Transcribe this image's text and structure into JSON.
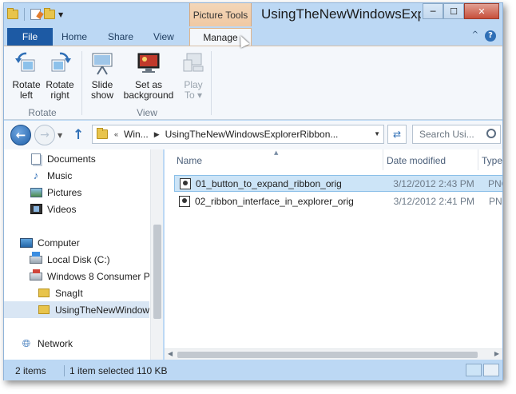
{
  "window": {
    "title": "UsingTheNewWindowsExplorerRibbon",
    "context_tab_group": "Picture Tools",
    "caption_buttons": {
      "minimize": "─",
      "maximize": "☐",
      "close": "✕"
    }
  },
  "tabs": [
    {
      "label": "File"
    },
    {
      "label": "Home"
    },
    {
      "label": "Share"
    },
    {
      "label": "View"
    },
    {
      "label": "Manage"
    }
  ],
  "tab_right": {
    "collapse": "^",
    "help": "?"
  },
  "ribbon": {
    "groups": [
      {
        "label": "Rotate",
        "buttons": [
          {
            "label": "Rotate left",
            "line1": "Rotate",
            "line2": "left",
            "icon": "rotate-left-icon"
          },
          {
            "label": "Rotate right",
            "line1": "Rotate",
            "line2": "right",
            "icon": "rotate-right-icon"
          }
        ]
      },
      {
        "label": "View",
        "buttons": [
          {
            "label": "Slide show",
            "line1": "Slide",
            "line2": "show",
            "icon": "slideshow-icon"
          },
          {
            "label": "Set as background",
            "line1": "Set as",
            "line2": "background",
            "icon": "set-background-icon"
          },
          {
            "label": "Play To",
            "line1": "Play",
            "line2": "To ▾",
            "icon": "play-to-icon",
            "disabled": true
          }
        ]
      }
    ]
  },
  "address": {
    "overflow": "«",
    "crumbs": [
      "Win...",
      "UsingTheNewWindowsExplorerRibbon..."
    ],
    "search_placeholder": "Search Usi..."
  },
  "nav_pane": {
    "items": [
      {
        "label": "Documents",
        "icon": "documents-icon"
      },
      {
        "label": "Music",
        "icon": "music-icon"
      },
      {
        "label": "Pictures",
        "icon": "pictures-icon"
      },
      {
        "label": "Videos",
        "icon": "videos-icon"
      },
      {
        "label": "Computer",
        "icon": "computer-icon"
      },
      {
        "label": "Local Disk (C:)",
        "icon": "local-disk-icon"
      },
      {
        "label": "Windows 8 Consumer P",
        "icon": "cd-drive-icon"
      },
      {
        "label": "SnagIt",
        "icon": "folder-icon"
      },
      {
        "label": "UsingTheNewWindow",
        "icon": "folder-icon",
        "selected": true
      },
      {
        "label": "Network",
        "icon": "network-icon"
      }
    ]
  },
  "file_list": {
    "columns": [
      "Name",
      "Date modified",
      "Type"
    ],
    "rows": [
      {
        "name": "01_button_to_expand_ribbon_orig",
        "date": "3/12/2012 2:43 PM",
        "type": "PNG",
        "selected": true
      },
      {
        "name": "02_ribbon_interface_in_explorer_orig",
        "date": "3/12/2012 2:41 PM",
        "type": "PNG",
        "selected": false
      }
    ]
  },
  "status": {
    "item_count": "2 items",
    "selection": "1 item selected  110 KB"
  },
  "colors": {
    "frame": "#bcd8f4",
    "file_tab": "#1d5aa4",
    "context_tab": "#f0c9a3",
    "selection": "#cce4f7"
  }
}
